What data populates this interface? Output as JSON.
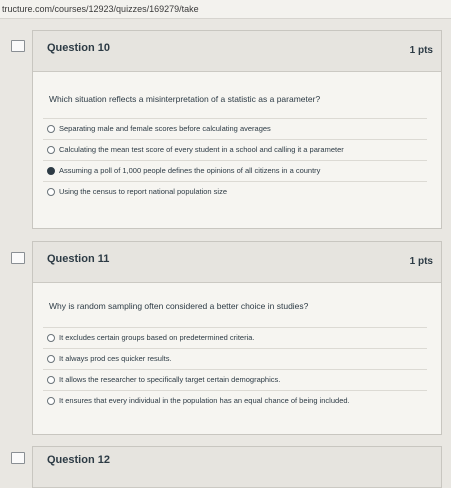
{
  "browser": {
    "url": "tructure.com/courses/12923/quizzes/169279/take"
  },
  "questions": [
    {
      "title": "Question 10",
      "points": "1 pts",
      "prompt": "Which situation reflects a misinterpretation of a statistic as a parameter?",
      "answers": [
        {
          "text": "Separating male and female scores before calculating averages",
          "selected": false
        },
        {
          "text": "Calculating the mean test score of every student in a school and calling it a parameter",
          "selected": false
        },
        {
          "text": "Assuming a poll of 1,000 people defines the opinions of all citizens in a country",
          "selected": true
        },
        {
          "text": "Using the census to report national population size",
          "selected": false
        }
      ]
    },
    {
      "title": "Question 11",
      "points": "1 pts",
      "prompt": "Why is random sampling often considered a better choice in studies?",
      "answers": [
        {
          "text": "It excludes certain groups based on predetermined criteria.",
          "selected": false
        },
        {
          "text": "It always prod  ces quicker results.",
          "selected": false
        },
        {
          "text": "It allows the researcher to specifically target certain demographics.",
          "selected": false
        },
        {
          "text": "It ensures that every individual in the population has an equal chance of being included.",
          "selected": false
        }
      ]
    },
    {
      "title": "Question 12"
    }
  ]
}
